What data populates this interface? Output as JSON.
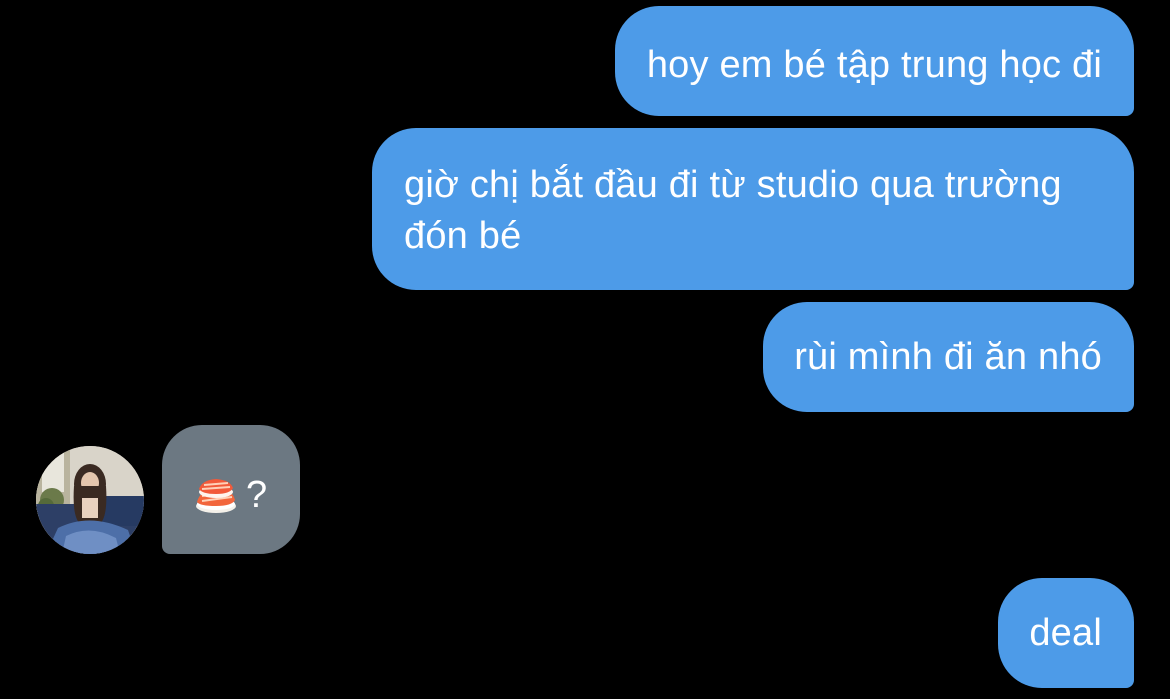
{
  "conversation": {
    "messages": [
      {
        "sender": "me",
        "text": "hoy em bé tập trung học đi"
      },
      {
        "sender": "me",
        "text": "giờ chị bắt đầu đi từ studio qua trường đón bé"
      },
      {
        "sender": "me",
        "text": "rùi mình đi ăn nhó"
      },
      {
        "sender": "contact",
        "emoji": "sushi-icon",
        "text": "?"
      },
      {
        "sender": "me",
        "text": "deal"
      }
    ]
  },
  "colors": {
    "background": "#000000",
    "outgoing_bubble": "#4d9be8",
    "incoming_bubble": "#6c7882",
    "text": "#ffffff"
  }
}
